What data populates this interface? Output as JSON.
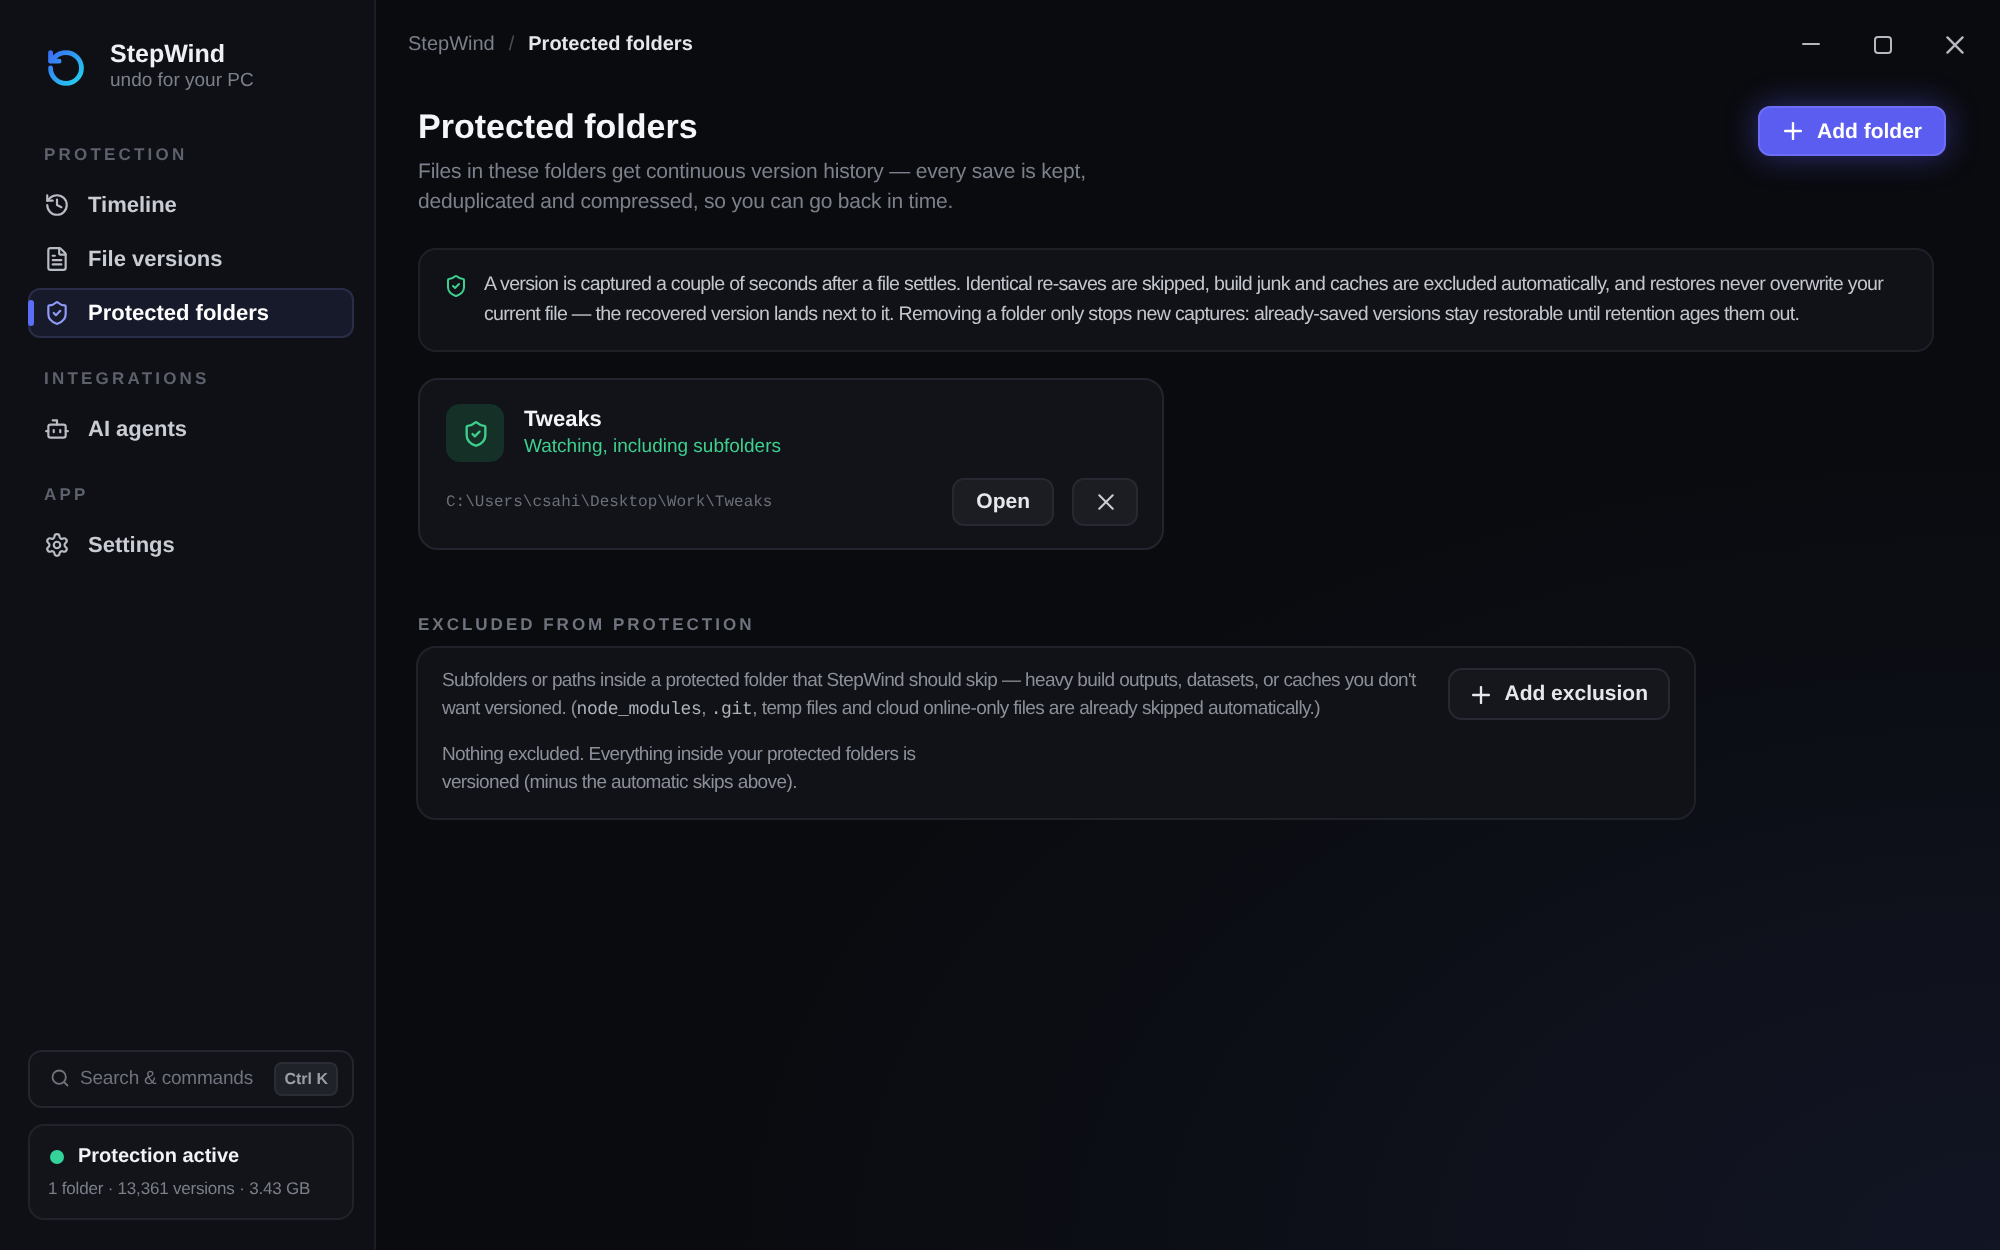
{
  "sidebar": {
    "brand": {
      "name": "StepWind",
      "tagline": "undo for your PC"
    },
    "sections": [
      {
        "heading": "PROTECTION",
        "items": [
          {
            "label": "Timeline",
            "selected": false
          },
          {
            "label": "File versions",
            "selected": false
          },
          {
            "label": "Protected folders",
            "selected": true
          }
        ]
      },
      {
        "heading": "INTEGRATIONS",
        "items": [
          {
            "label": "AI agents",
            "selected": false
          }
        ]
      },
      {
        "heading": "APP",
        "items": [
          {
            "label": "Settings",
            "selected": false
          }
        ]
      }
    ],
    "search": {
      "placeholder": "Search & commands",
      "shortcut": "Ctrl K"
    },
    "status": {
      "title": "Protection active",
      "detail": "1 folder · 13,361 versions · 3.43 GB",
      "active": true
    }
  },
  "breadcrumb": {
    "items": [
      "StepWind",
      "Protected folders"
    ],
    "separator": "/"
  },
  "header": {
    "title": "Protected folders",
    "subtitle": "Files in these folders get continuous version history — every save is kept, deduplicated and compressed, so you can go back in time.",
    "action": "Add folder"
  },
  "notice": {
    "text": "A version is captured a couple of seconds after a file settles. Identical re-saves are skipped, build junk and caches are excluded automatically, and restores never overwrite your current file — the recovered version lands next to it. Removing a folder only stops new captures: already-saved versions stay restorable until retention ages them out."
  },
  "folders": [
    {
      "name": "Tweaks",
      "status": "Watching, including subfolders",
      "watching": true,
      "path": "C:\\Users\\csahi\\Desktop\\Work\\Tweaks",
      "open_label": "Open"
    }
  ],
  "exclusions": {
    "heading": "EXCLUDED FROM PROTECTION",
    "description": [
      {
        "kind": "text",
        "text": "Subfolders or paths inside a protected folder that StepWind should skip — heavy build outputs, datasets, or caches you don't want versioned. ("
      },
      {
        "kind": "code",
        "text": "node_modules"
      },
      {
        "kind": "text",
        "text": ", "
      },
      {
        "kind": "code",
        "text": ".git"
      },
      {
        "kind": "text",
        "text": ", temp files and cloud online-only files are already skipped automatically.)"
      }
    ],
    "empty_message": "Nothing excluded. Everything inside your protected folders is versioned (minus the automatic skips above).",
    "action": "Add exclusion"
  }
}
